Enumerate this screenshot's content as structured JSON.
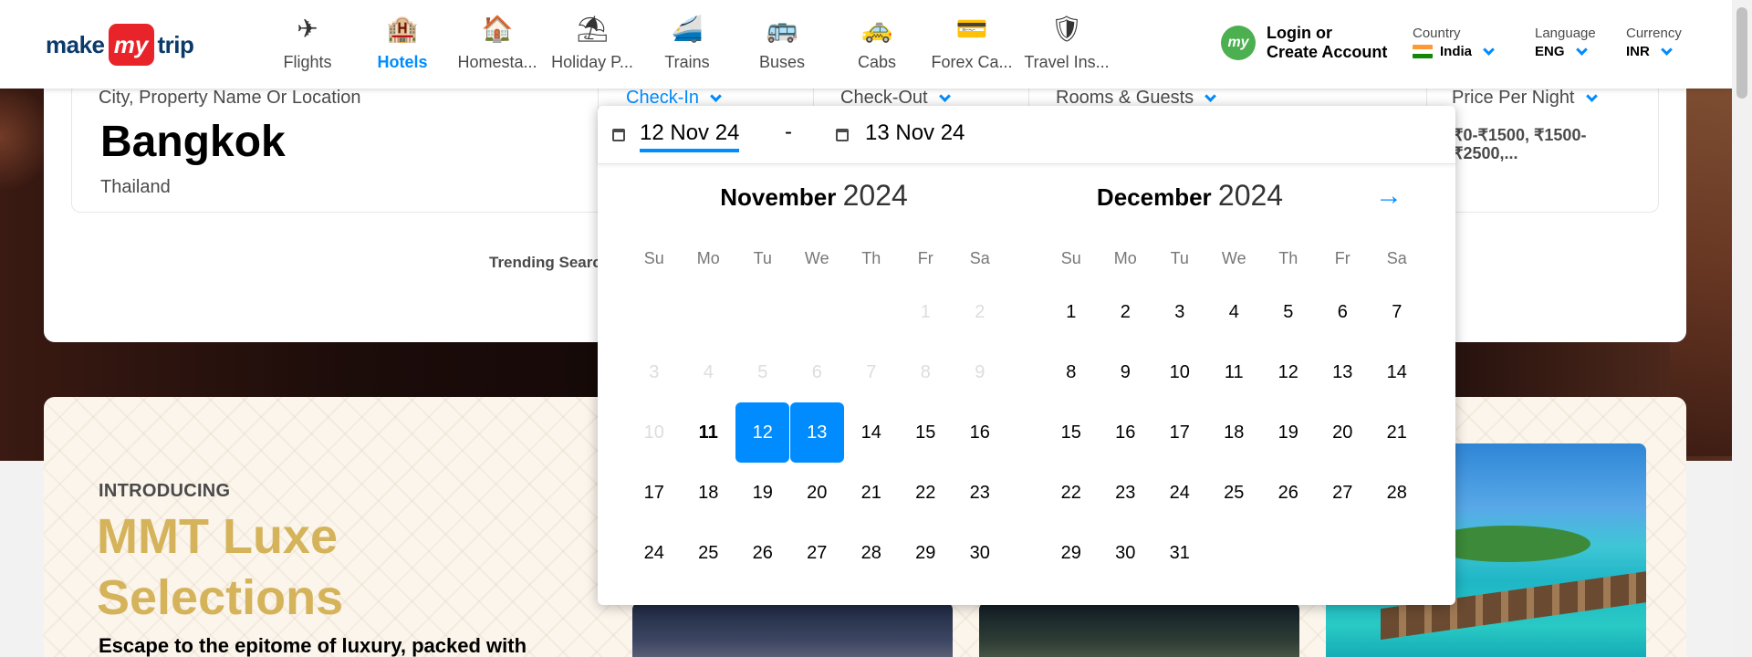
{
  "header": {
    "logo": {
      "make": "make",
      "my": "my",
      "trip": "trip"
    },
    "nav": [
      {
        "label": "Flights",
        "icon": "plane-icon",
        "active": false
      },
      {
        "label": "Hotels",
        "icon": "hotel-icon",
        "active": true
      },
      {
        "label": "Homesta...",
        "icon": "homestay-icon",
        "active": false
      },
      {
        "label": "Holiday P...",
        "icon": "holiday-icon",
        "active": false
      },
      {
        "label": "Trains",
        "icon": "train-icon",
        "active": false
      },
      {
        "label": "Buses",
        "icon": "bus-icon",
        "active": false
      },
      {
        "label": "Cabs",
        "icon": "cab-icon",
        "active": false
      },
      {
        "label": "Forex Ca...",
        "icon": "forex-icon",
        "active": false
      },
      {
        "label": "Travel Ins...",
        "icon": "insurance-icon",
        "active": false
      }
    ],
    "login": {
      "avatar": "my",
      "line1": "Login or",
      "line2": "Create Account"
    },
    "country": {
      "label": "Country",
      "value": "India"
    },
    "language": {
      "label": "Language",
      "value": "ENG"
    },
    "currency": {
      "label": "Currency",
      "value": "INR"
    }
  },
  "search": {
    "city_label": "City, Property Name Or Location",
    "city": "Bangkok",
    "country": "Thailand",
    "checkin_label": "Check-In",
    "checkout_label": "Check-Out",
    "rooms_label": "Rooms & Guests",
    "price_label": "Price Per Night",
    "price_value": "₹0-₹1500, ₹1500-₹2500,...",
    "trending": "Trending Searc"
  },
  "calendar": {
    "checkin": "12 Nov 24",
    "dash": "-",
    "checkout": "13 Nov 24",
    "weekdays": [
      "Su",
      "Mo",
      "Tu",
      "We",
      "Th",
      "Fr",
      "Sa"
    ],
    "months": [
      {
        "name": "November",
        "year": "2024",
        "offset": 5,
        "days": 30,
        "disabled_until": 10,
        "today": 11,
        "selected": [
          12,
          13
        ]
      },
      {
        "name": "December",
        "year": "2024",
        "offset": 0,
        "days": 31,
        "disabled_until": 0,
        "today": 0,
        "selected": []
      }
    ]
  },
  "luxe": {
    "intro": "INTRODUCING",
    "title_line1": "MMT Luxe",
    "title_line2": "Selections",
    "desc": "Escape to the epitome of luxury, packed with"
  },
  "colors": {
    "accent": "#008cff",
    "gold": "#d5b35b",
    "brand_red": "#e8242a"
  }
}
